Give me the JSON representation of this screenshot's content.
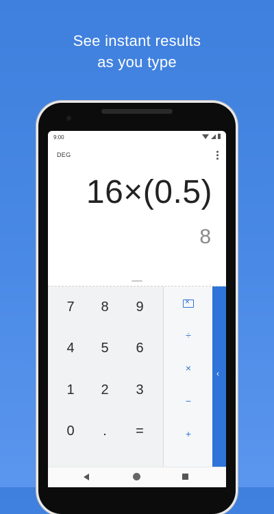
{
  "headline": {
    "line1": "See instant results",
    "line2": "as you type"
  },
  "status": {
    "time": "9:00"
  },
  "calculator": {
    "mode": "DEG",
    "expression": "16×(0.5)",
    "result": "8",
    "keys": [
      [
        "7",
        "8",
        "9"
      ],
      [
        "4",
        "5",
        "6"
      ],
      [
        "1",
        "2",
        "3"
      ],
      [
        "0",
        ".",
        "="
      ]
    ],
    "ops": [
      "÷",
      "×",
      "−",
      "+"
    ],
    "advanced_toggle": "‹"
  },
  "icons": {
    "backspace": "backspace-icon",
    "menu": "overflow-menu-icon",
    "nav_back": "back-icon",
    "nav_home": "home-icon",
    "nav_recent": "recents-icon"
  },
  "colors": {
    "accent": "#2f74d9",
    "background": "#4a8ae6"
  }
}
